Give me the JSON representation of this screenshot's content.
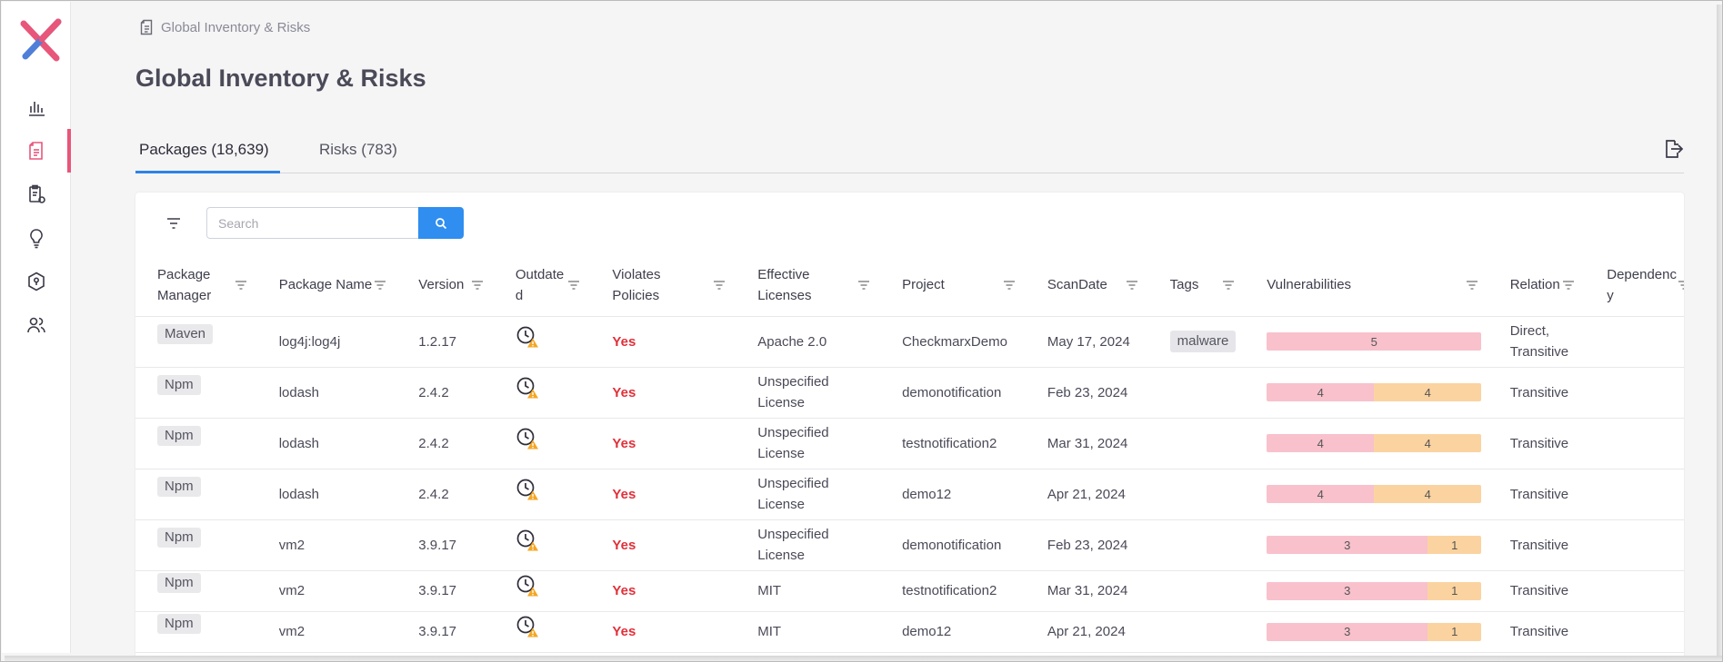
{
  "app": {
    "accent": "#e8567a",
    "primary": "#2f8ef0"
  },
  "sidebar": {
    "items": [
      {
        "name": "analytics",
        "icon": "bar-chart-icon"
      },
      {
        "name": "inventory",
        "icon": "document-icon",
        "active": true
      },
      {
        "name": "policies",
        "icon": "clipboard-gear-icon"
      },
      {
        "name": "insights",
        "icon": "lightbulb-icon"
      },
      {
        "name": "security",
        "icon": "shield-lock-icon"
      },
      {
        "name": "users",
        "icon": "users-icon"
      }
    ]
  },
  "breadcrumb": {
    "label": "Global Inventory & Risks"
  },
  "page": {
    "title": "Global Inventory & Risks"
  },
  "tabs": [
    {
      "label": "Packages (18,639)",
      "active": true
    },
    {
      "label": "Risks (783)",
      "active": false
    }
  ],
  "search": {
    "placeholder": "Search",
    "value": ""
  },
  "table": {
    "headers": [
      "Package\nManager",
      "Package Name",
      "Version",
      "Outdate\nd",
      "Violates\nPolicies",
      "Effective\nLicenses",
      "Project",
      "ScanDate",
      "Tags",
      "Vulnerabilities",
      "Relation",
      "Dependenc\ny"
    ],
    "rows": [
      {
        "manager": "Maven",
        "name": "log4j:log4j",
        "version": "1.2.17",
        "violates": "Yes",
        "license": "Apache 2.0",
        "project": "CheckmarxDemo",
        "date": "May 17, 2024",
        "tag": "malware",
        "vulns": [
          {
            "level": "high",
            "count": 5
          }
        ],
        "relation": "Direct,\nTransitive",
        "dependency": ""
      },
      {
        "manager": "Npm",
        "name": "lodash",
        "version": "2.4.2",
        "violates": "Yes",
        "license": "Unspecified\nLicense",
        "project": "demonotification",
        "date": "Feb 23, 2024",
        "tag": "",
        "vulns": [
          {
            "level": "high",
            "count": 4
          },
          {
            "level": "medium",
            "count": 4
          }
        ],
        "relation": "Transitive",
        "dependency": ""
      },
      {
        "manager": "Npm",
        "name": "lodash",
        "version": "2.4.2",
        "violates": "Yes",
        "license": "Unspecified\nLicense",
        "project": "testnotification2",
        "date": "Mar 31, 2024",
        "tag": "",
        "vulns": [
          {
            "level": "high",
            "count": 4
          },
          {
            "level": "medium",
            "count": 4
          }
        ],
        "relation": "Transitive",
        "dependency": ""
      },
      {
        "manager": "Npm",
        "name": "lodash",
        "version": "2.4.2",
        "violates": "Yes",
        "license": "Unspecified\nLicense",
        "project": "demo12",
        "date": "Apr 21, 2024",
        "tag": "",
        "vulns": [
          {
            "level": "high",
            "count": 4
          },
          {
            "level": "medium",
            "count": 4
          }
        ],
        "relation": "Transitive",
        "dependency": ""
      },
      {
        "manager": "Npm",
        "name": "vm2",
        "version": "3.9.17",
        "violates": "Yes",
        "license": "Unspecified\nLicense",
        "project": "demonotification",
        "date": "Feb 23, 2024",
        "tag": "",
        "vulns": [
          {
            "level": "high",
            "count": 3
          },
          {
            "level": "medium",
            "count": 1
          }
        ],
        "relation": "Transitive",
        "dependency": ""
      },
      {
        "manager": "Npm",
        "name": "vm2",
        "version": "3.9.17",
        "violates": "Yes",
        "license": "MIT",
        "project": "testnotification2",
        "date": "Mar 31, 2024",
        "tag": "",
        "vulns": [
          {
            "level": "high",
            "count": 3
          },
          {
            "level": "medium",
            "count": 1
          }
        ],
        "relation": "Transitive",
        "dependency": ""
      },
      {
        "manager": "Npm",
        "name": "vm2",
        "version": "3.9.17",
        "violates": "Yes",
        "license": "MIT",
        "project": "demo12",
        "date": "Apr 21, 2024",
        "tag": "",
        "vulns": [
          {
            "level": "high",
            "count": 3
          },
          {
            "level": "medium",
            "count": 1
          }
        ],
        "relation": "Transitive",
        "dependency": ""
      }
    ]
  }
}
